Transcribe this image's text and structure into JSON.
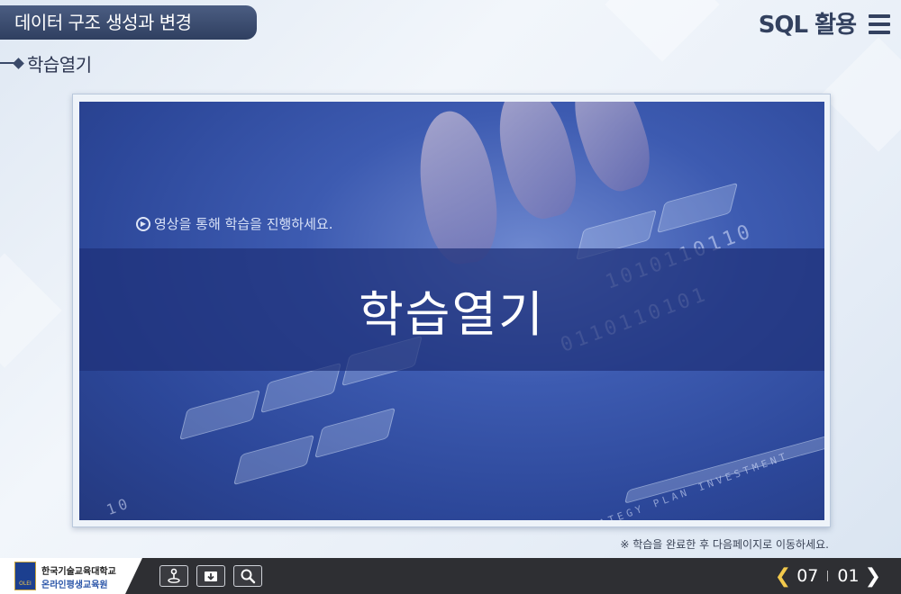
{
  "header": {
    "lesson_title": "데이터 구조 생성과 변경",
    "section_title": "학습열기",
    "course_name": "SQL 활용"
  },
  "video": {
    "guide_text": "영상을 통해 학습을 진행하세요.",
    "band_title": "학습열기",
    "background_bits": [
      "1010110110",
      "0110110101",
      "10",
      "STRATEGY PLAN INVESTMENT"
    ]
  },
  "notice": "※ 학습을 완료한 후 다음페이지로 이동하세요.",
  "footer": {
    "university_name": "한국기술교육대학교",
    "institute_name": "온라인평생교육원",
    "logo_caption": "OLEI",
    "tools": [
      {
        "name": "tool-location-button",
        "icon": "person-pin-icon"
      },
      {
        "name": "tool-download-button",
        "icon": "download-icon"
      },
      {
        "name": "tool-search-button",
        "icon": "magnifier-icon"
      }
    ],
    "current_page": "07",
    "total_pages": "01"
  },
  "colors": {
    "title_tab": "#3b4b6e",
    "band": "#1e3078",
    "footer": "#2e2f33",
    "prev_arrow": "#f2c94c"
  }
}
